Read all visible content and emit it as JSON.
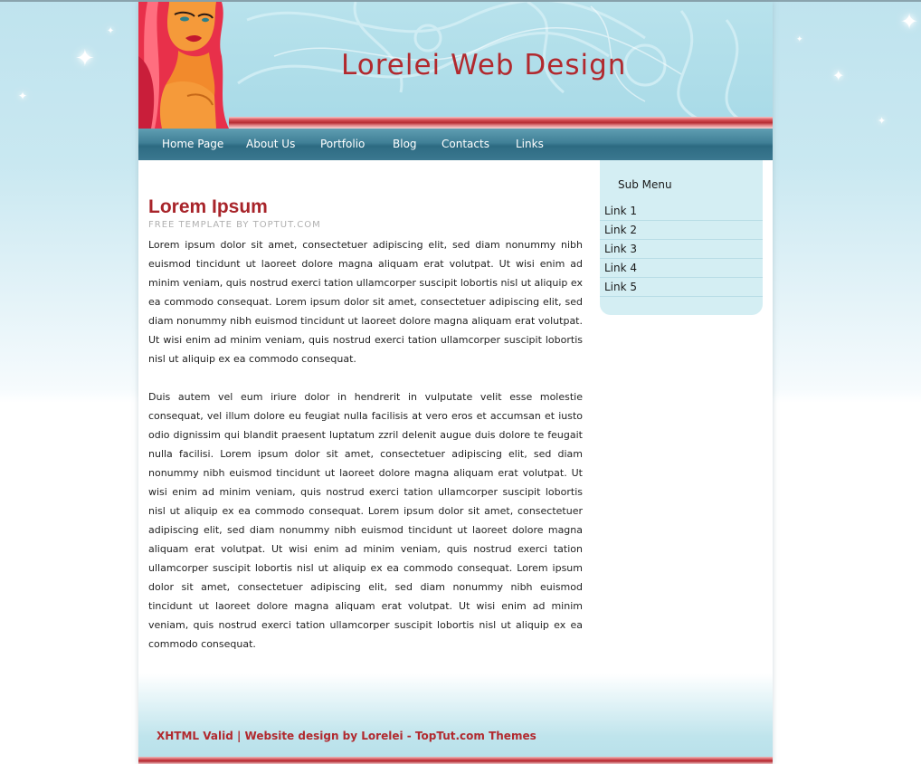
{
  "header": {
    "site_title": "Lorelei Web Design"
  },
  "nav": {
    "items": [
      "Home Page",
      "About Us",
      "Portfolio",
      "Blog",
      "Contacts",
      "Links"
    ]
  },
  "post": {
    "title": "Lorem Ipsum",
    "byline": "FREE TEMPLATE BY TOPTUT.COM",
    "paragraphs": [
      "Lorem ipsum dolor sit amet, consectetuer adipiscing elit, sed diam nonummy nibh euismod tincidunt ut laoreet dolore magna aliquam erat volutpat. Ut wisi enim ad minim veniam, quis nostrud exerci tation ullamcorper suscipit lobortis nisl ut aliquip ex ea commodo consequat. Lorem ipsum dolor sit amet, consectetuer adipiscing elit, sed diam nonummy nibh euismod tincidunt ut laoreet dolore magna aliquam erat volutpat. Ut wisi enim ad minim veniam, quis nostrud exerci tation ullamcorper suscipit lobortis nisl ut aliquip ex ea commodo consequat.",
      "Duis autem vel eum iriure dolor in hendrerit in vulputate velit esse molestie consequat, vel illum dolore eu feugiat nulla facilisis at vero eros et accumsan et iusto odio dignissim qui blandit praesent luptatum zzril delenit augue duis dolore te feugait nulla facilisi. Lorem ipsum dolor sit amet, consectetuer adipiscing elit, sed diam nonummy nibh euismod tincidunt ut laoreet dolore magna aliquam erat volutpat. Ut wisi enim ad minim veniam, quis nostrud exerci tation ullamcorper suscipit lobortis nisl ut aliquip ex ea commodo consequat. Lorem ipsum dolor sit amet, consectetuer adipiscing elit, sed diam nonummy nibh euismod tincidunt ut laoreet dolore magna aliquam erat volutpat. Ut wisi enim ad minim veniam, quis nostrud exerci tation ullamcorper suscipit lobortis nisl ut aliquip ex ea commodo consequat. Lorem ipsum dolor sit amet, consectetuer adipiscing elit, sed diam nonummy nibh euismod tincidunt ut laoreet dolore magna aliquam erat volutpat. Ut wisi enim ad minim veniam, quis nostrud exerci tation ullamcorper suscipit lobortis nisl ut aliquip ex ea commodo consequat."
    ]
  },
  "sidebar": {
    "title": "Sub Menu",
    "links": [
      "Link 1",
      "Link 2",
      "Link 3",
      "Link 4",
      "Link 5"
    ]
  },
  "footer": {
    "text": "XHTML Valid | Website design by Lorelei - TopTut.com Themes"
  },
  "colors": {
    "accent_red": "#b1292e",
    "nav_blue": "#3f7f96",
    "header_sky": "#a8dae7",
    "sidebar_bg": "#d4eef3"
  },
  "icons": {
    "header_art": "woman-illustration-icon",
    "background_decor": "sparkle-icon"
  }
}
